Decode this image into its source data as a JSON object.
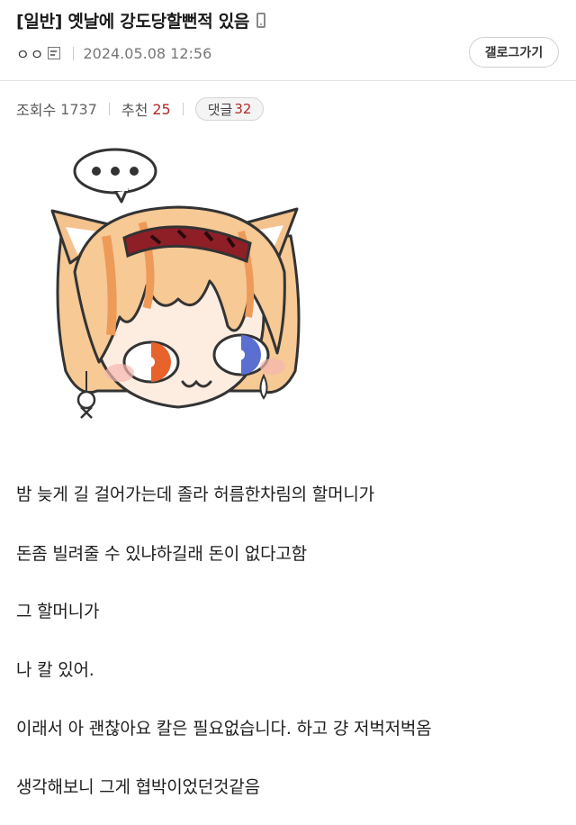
{
  "post": {
    "title": "[일반] 옛날에 강도당할뻔적 있음",
    "author": "ㅇㅇ",
    "date": "2024.05.08 12:56",
    "gallery_button": "갤로그가기"
  },
  "stats": {
    "views_label": "조회수",
    "views": "1737",
    "recommend_label": "추천",
    "recommend": "25",
    "comments_label": "댓글",
    "comments": "32"
  },
  "body": {
    "lines": [
      "밤 늦게 길 걸어가는데 졸라 허름한차림의 할머니가",
      "돈좀 빌려줄 수 있냐하길래 돈이 없다고함",
      "그 할머니가",
      "나 칼 있어.",
      "이래서 아 괜찮아요 칼은 필요없습니다. 하고 걍 저벅저벅옴",
      "생각해보니 그게 협박이었던것같음"
    ]
  },
  "image": {
    "speech_bubble": "•••"
  },
  "colors": {
    "accent_red": "#b02a2a",
    "hair": "#f3c08a",
    "headband": "#8e1f26",
    "eye_left": "#e8622b",
    "eye_right": "#5a6fd0"
  }
}
